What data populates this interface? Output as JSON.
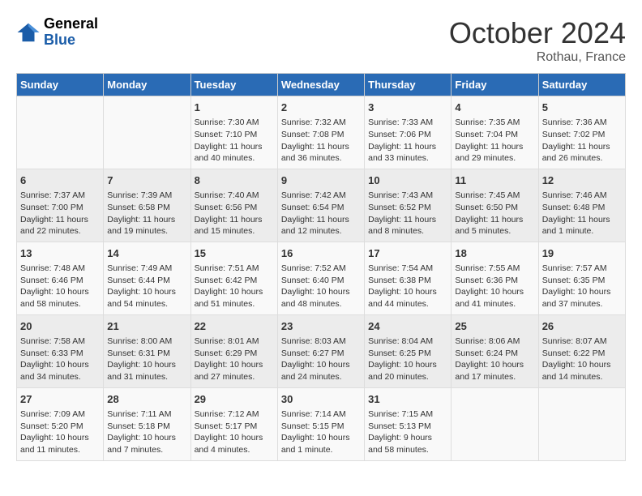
{
  "header": {
    "logo": {
      "general": "General",
      "blue": "Blue"
    },
    "title": "October 2024",
    "location": "Rothau, France"
  },
  "days_of_week": [
    "Sunday",
    "Monday",
    "Tuesday",
    "Wednesday",
    "Thursday",
    "Friday",
    "Saturday"
  ],
  "weeks": [
    [
      {
        "day": "",
        "sunrise": "",
        "sunset": "",
        "daylight": ""
      },
      {
        "day": "",
        "sunrise": "",
        "sunset": "",
        "daylight": ""
      },
      {
        "day": "1",
        "sunrise": "Sunrise: 7:30 AM",
        "sunset": "Sunset: 7:10 PM",
        "daylight": "Daylight: 11 hours and 40 minutes."
      },
      {
        "day": "2",
        "sunrise": "Sunrise: 7:32 AM",
        "sunset": "Sunset: 7:08 PM",
        "daylight": "Daylight: 11 hours and 36 minutes."
      },
      {
        "day": "3",
        "sunrise": "Sunrise: 7:33 AM",
        "sunset": "Sunset: 7:06 PM",
        "daylight": "Daylight: 11 hours and 33 minutes."
      },
      {
        "day": "4",
        "sunrise": "Sunrise: 7:35 AM",
        "sunset": "Sunset: 7:04 PM",
        "daylight": "Daylight: 11 hours and 29 minutes."
      },
      {
        "day": "5",
        "sunrise": "Sunrise: 7:36 AM",
        "sunset": "Sunset: 7:02 PM",
        "daylight": "Daylight: 11 hours and 26 minutes."
      }
    ],
    [
      {
        "day": "6",
        "sunrise": "Sunrise: 7:37 AM",
        "sunset": "Sunset: 7:00 PM",
        "daylight": "Daylight: 11 hours and 22 minutes."
      },
      {
        "day": "7",
        "sunrise": "Sunrise: 7:39 AM",
        "sunset": "Sunset: 6:58 PM",
        "daylight": "Daylight: 11 hours and 19 minutes."
      },
      {
        "day": "8",
        "sunrise": "Sunrise: 7:40 AM",
        "sunset": "Sunset: 6:56 PM",
        "daylight": "Daylight: 11 hours and 15 minutes."
      },
      {
        "day": "9",
        "sunrise": "Sunrise: 7:42 AM",
        "sunset": "Sunset: 6:54 PM",
        "daylight": "Daylight: 11 hours and 12 minutes."
      },
      {
        "day": "10",
        "sunrise": "Sunrise: 7:43 AM",
        "sunset": "Sunset: 6:52 PM",
        "daylight": "Daylight: 11 hours and 8 minutes."
      },
      {
        "day": "11",
        "sunrise": "Sunrise: 7:45 AM",
        "sunset": "Sunset: 6:50 PM",
        "daylight": "Daylight: 11 hours and 5 minutes."
      },
      {
        "day": "12",
        "sunrise": "Sunrise: 7:46 AM",
        "sunset": "Sunset: 6:48 PM",
        "daylight": "Daylight: 11 hours and 1 minute."
      }
    ],
    [
      {
        "day": "13",
        "sunrise": "Sunrise: 7:48 AM",
        "sunset": "Sunset: 6:46 PM",
        "daylight": "Daylight: 10 hours and 58 minutes."
      },
      {
        "day": "14",
        "sunrise": "Sunrise: 7:49 AM",
        "sunset": "Sunset: 6:44 PM",
        "daylight": "Daylight: 10 hours and 54 minutes."
      },
      {
        "day": "15",
        "sunrise": "Sunrise: 7:51 AM",
        "sunset": "Sunset: 6:42 PM",
        "daylight": "Daylight: 10 hours and 51 minutes."
      },
      {
        "day": "16",
        "sunrise": "Sunrise: 7:52 AM",
        "sunset": "Sunset: 6:40 PM",
        "daylight": "Daylight: 10 hours and 48 minutes."
      },
      {
        "day": "17",
        "sunrise": "Sunrise: 7:54 AM",
        "sunset": "Sunset: 6:38 PM",
        "daylight": "Daylight: 10 hours and 44 minutes."
      },
      {
        "day": "18",
        "sunrise": "Sunrise: 7:55 AM",
        "sunset": "Sunset: 6:36 PM",
        "daylight": "Daylight: 10 hours and 41 minutes."
      },
      {
        "day": "19",
        "sunrise": "Sunrise: 7:57 AM",
        "sunset": "Sunset: 6:35 PM",
        "daylight": "Daylight: 10 hours and 37 minutes."
      }
    ],
    [
      {
        "day": "20",
        "sunrise": "Sunrise: 7:58 AM",
        "sunset": "Sunset: 6:33 PM",
        "daylight": "Daylight: 10 hours and 34 minutes."
      },
      {
        "day": "21",
        "sunrise": "Sunrise: 8:00 AM",
        "sunset": "Sunset: 6:31 PM",
        "daylight": "Daylight: 10 hours and 31 minutes."
      },
      {
        "day": "22",
        "sunrise": "Sunrise: 8:01 AM",
        "sunset": "Sunset: 6:29 PM",
        "daylight": "Daylight: 10 hours and 27 minutes."
      },
      {
        "day": "23",
        "sunrise": "Sunrise: 8:03 AM",
        "sunset": "Sunset: 6:27 PM",
        "daylight": "Daylight: 10 hours and 24 minutes."
      },
      {
        "day": "24",
        "sunrise": "Sunrise: 8:04 AM",
        "sunset": "Sunset: 6:25 PM",
        "daylight": "Daylight: 10 hours and 20 minutes."
      },
      {
        "day": "25",
        "sunrise": "Sunrise: 8:06 AM",
        "sunset": "Sunset: 6:24 PM",
        "daylight": "Daylight: 10 hours and 17 minutes."
      },
      {
        "day": "26",
        "sunrise": "Sunrise: 8:07 AM",
        "sunset": "Sunset: 6:22 PM",
        "daylight": "Daylight: 10 hours and 14 minutes."
      }
    ],
    [
      {
        "day": "27",
        "sunrise": "Sunrise: 7:09 AM",
        "sunset": "Sunset: 5:20 PM",
        "daylight": "Daylight: 10 hours and 11 minutes."
      },
      {
        "day": "28",
        "sunrise": "Sunrise: 7:11 AM",
        "sunset": "Sunset: 5:18 PM",
        "daylight": "Daylight: 10 hours and 7 minutes."
      },
      {
        "day": "29",
        "sunrise": "Sunrise: 7:12 AM",
        "sunset": "Sunset: 5:17 PM",
        "daylight": "Daylight: 10 hours and 4 minutes."
      },
      {
        "day": "30",
        "sunrise": "Sunrise: 7:14 AM",
        "sunset": "Sunset: 5:15 PM",
        "daylight": "Daylight: 10 hours and 1 minute."
      },
      {
        "day": "31",
        "sunrise": "Sunrise: 7:15 AM",
        "sunset": "Sunset: 5:13 PM",
        "daylight": "Daylight: 9 hours and 58 minutes."
      },
      {
        "day": "",
        "sunrise": "",
        "sunset": "",
        "daylight": ""
      },
      {
        "day": "",
        "sunrise": "",
        "sunset": "",
        "daylight": ""
      }
    ]
  ]
}
